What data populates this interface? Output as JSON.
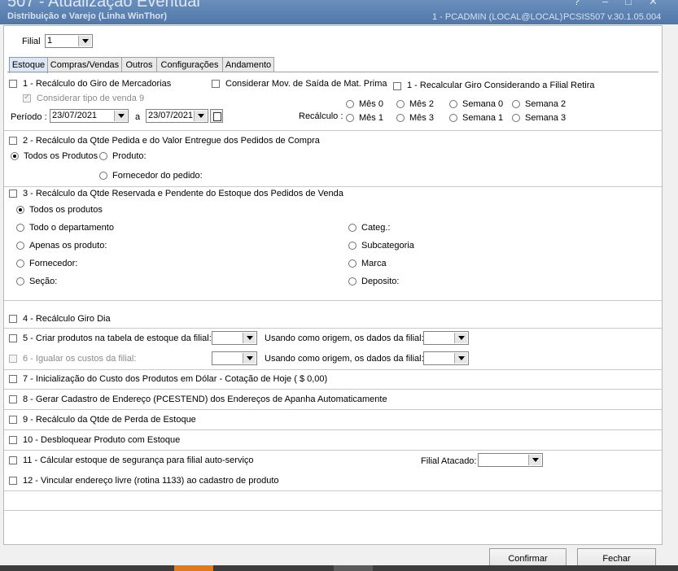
{
  "window": {
    "title": "507 - Atualização Eventual",
    "subtitle": "Distribuição e Varejo (Linha WinThor)",
    "user": "1 - PCADMIN (LOCAL@LOCAL)",
    "version": "PCSIS507  v.30.1.05.004"
  },
  "filial": {
    "label": "Filial",
    "value": "1"
  },
  "tabs": [
    {
      "label": "Estoque"
    },
    {
      "label": "Compras/Vendas"
    },
    {
      "label": "Outros"
    },
    {
      "label": "Configurações"
    },
    {
      "label": "Andamento"
    }
  ],
  "section1": {
    "recalculo_giro": "1 - Recálculo do Giro de Mercadorias",
    "considerar_mov": "Considerar Mov. de Saída de Mat. Prima",
    "recalcular_filial": "1 - Recalcular Giro Considerando a Filial Retira",
    "considerar_tipo": "Considerar tipo de venda 9",
    "periodo_label": "Período :",
    "date_from": "23/07/2021",
    "a_label": "a",
    "date_to": "23/07/2021",
    "recalculo_label": "Recálculo :",
    "options": [
      "Mês 0",
      "Mês 2",
      "Semana 0",
      "Semana 2",
      "Mês 1",
      "Mês 3",
      "Semana 1",
      "Semana 3"
    ]
  },
  "section2": {
    "title": "2 - Recálculo da Qtde Pedida e do Valor Entregue dos Pedidos de Compra",
    "todos": "Todos os Produtos",
    "produto": "Produto:",
    "fornecedor": "Fornecedor do pedido:"
  },
  "section3": {
    "title": "3 - Recálculo da Qtde Reservada e Pendente do Estoque dos Pedidos de Venda",
    "left": [
      "Todos os produtos",
      "Todo o departamento",
      "Apenas os produto:",
      "Fornecedor:",
      "Seção:"
    ],
    "right": [
      "Categ.:",
      "Subcategoria",
      "Marca",
      "Deposito:"
    ]
  },
  "items": {
    "item4": "4 - Recálculo Giro Dia",
    "item5": "5 - Criar produtos na tabela de estoque da filial:",
    "item5_origem": "Usando como origem, os dados da filial:",
    "item6": "6 - Igualar os custos da filial:",
    "item6_origem": "Usando como origem, os dados da filial:",
    "item7": "7 - Inicialização do Custo dos Produtos em Dólar - Cotação de Hoje ( $ 0,00)",
    "item8": "8 - Gerar Cadastro de Endereço (PCESTEND) dos Endereços de Apanha Automaticamente",
    "item9": "9 - Recálculo da Qtde de Perda de Estoque",
    "item10": "10 - Desbloquear Produto com Estoque",
    "item11": "11 - Cálcular estoque de segurança para filial auto-serviço",
    "filial_atacado": "Filial Atacado:",
    "item12": "12 - Vincular endereço livre (rotina 1133) ao cadastro de produto"
  },
  "buttons": {
    "confirmar": "Confirmar",
    "fechar": "Fechar"
  },
  "colors": {
    "title_bar": "#4f77a9",
    "active_tab": "#dce6f4",
    "taskbar_accent": "#e07a20"
  }
}
